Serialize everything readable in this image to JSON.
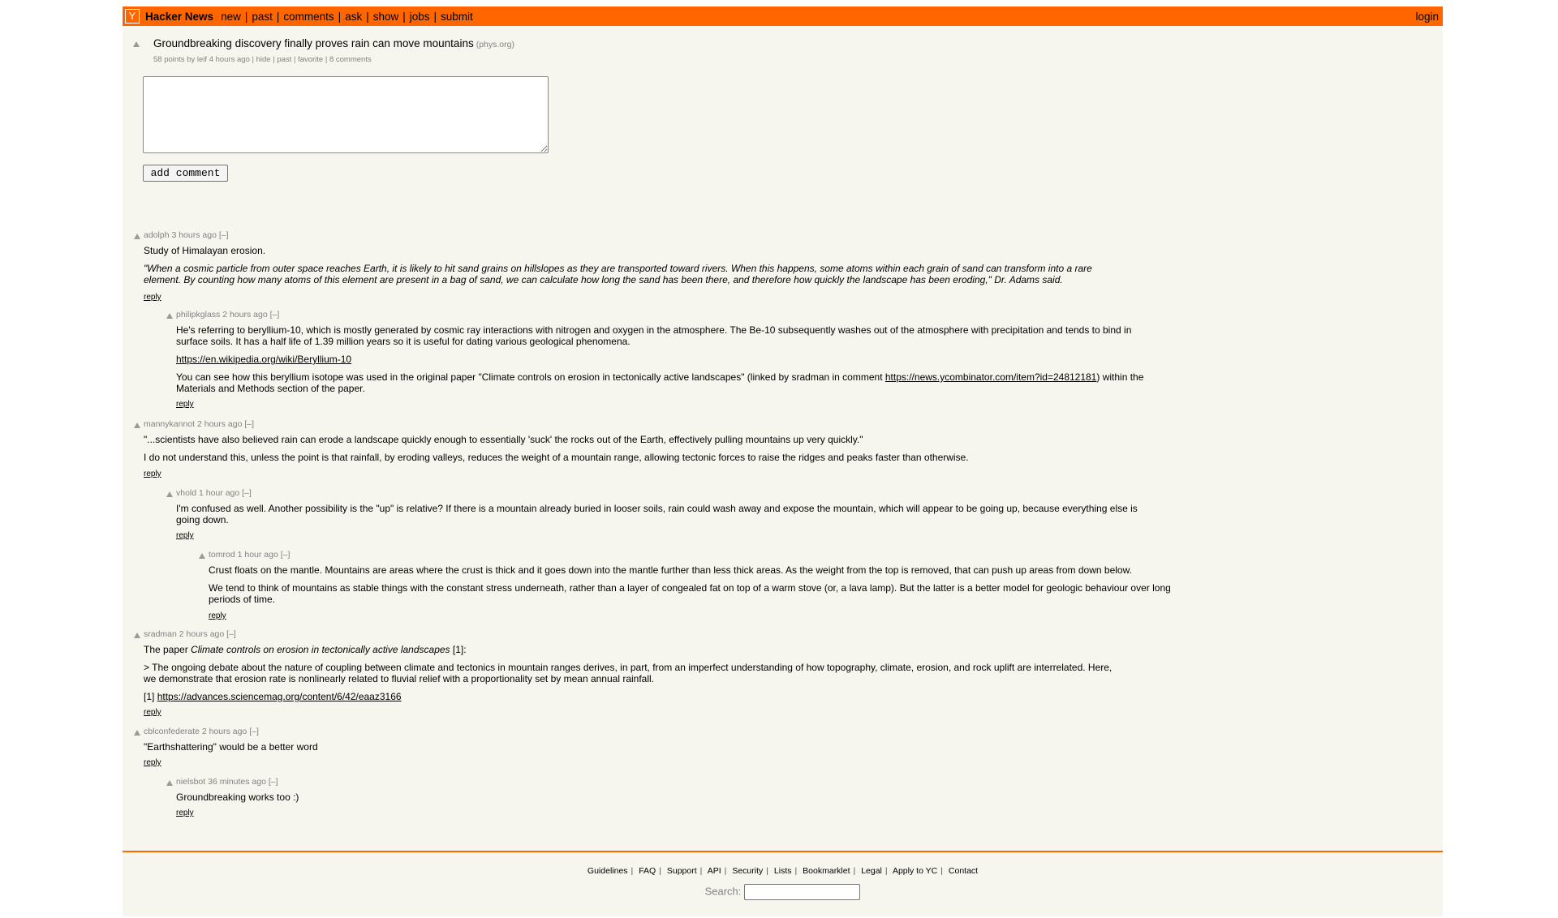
{
  "header": {
    "logo_letter": "Y",
    "brand": "Hacker News",
    "nav": [
      "new",
      "past",
      "comments",
      "ask",
      "show",
      "jobs",
      "submit"
    ],
    "login": "login"
  },
  "story": {
    "title": "Groundbreaking discovery finally proves rain can move mountains",
    "site": "(phys.org)",
    "points": "58 points",
    "by": "by",
    "user": "leif",
    "age": "4 hours ago",
    "hide": "hide",
    "past": "past",
    "favorite": "favorite",
    "comments": "8 comments"
  },
  "add_comment": "add comment",
  "comments": [
    {
      "user": "adolph",
      "age": "3 hours ago",
      "toggle": "[–]",
      "paragraphs": [
        "Study of Himalayan erosion.",
        "\"When a cosmic particle from outer space reaches Earth, it is likely to hit sand grains on hillslopes as they are transported toward rivers. When this happens, some atoms within each grain of sand can transform into a rare element. By counting how many atoms of this element are present in a bag of sand, we can calculate how long the sand has been there, and therefore how quickly the landscape has been eroding,\" Dr. Adams said."
      ],
      "reply": "reply"
    },
    {
      "user": "philipkglass",
      "age": "2 hours ago",
      "toggle": "[–]",
      "paragraphs": [
        "He's referring to beryllium-10, which is mostly generated by cosmic ray interactions with nitrogen and oxygen in the atmosphere. The Be-10 subsequently washes out of the atmosphere with precipitation and tends to bind in surface soils. It has a half life of 1.39 million years so it is useful for dating various geological phenomena.",
        "https://en.wikipedia.org/wiki/Beryllium-10",
        "You can see how this beryllium isotope was used in the original paper \"Climate controls on erosion in tectonically active landscapes\" (linked by sradman in comment ",
        "https://news.ycombinator.com/item?id=24812181",
        ") within the Materials and Methods section of the paper."
      ],
      "reply": "reply"
    },
    {
      "user": "mannykannot",
      "age": "2 hours ago",
      "toggle": "[–]",
      "paragraphs": [
        "\"...scientists have also believed rain can erode a landscape quickly enough to essentially 'suck' the rocks out of the Earth, effectively pulling mountains up very quickly.\"",
        "I do not understand this, unless the point is that rainfall, by eroding valleys, reduces the weight of a mountain range, allowing tectonic forces to raise the ridges and peaks faster than otherwise."
      ],
      "reply": "reply"
    },
    {
      "user": "vhold",
      "age": "1 hour ago",
      "toggle": "[–]",
      "paragraphs": [
        "I'm confused as well. Another possibility is the \"up\" is relative? If there is a mountain already buried in looser soils, rain could wash away and expose the mountain, which will appear to be going up, because everything else is going down."
      ],
      "reply": "reply"
    },
    {
      "user": "tomrod",
      "age": "1 hour ago",
      "toggle": "[–]",
      "paragraphs": [
        "Crust floats on the mantle. Mountains are areas where the crust is thick and it goes down into the mantle further than less thick areas. As the weight from the top is removed, that can push up areas from down below.",
        "We tend to think of mountains as stable things with the constant stress underneath, rather than a layer of congealed fat on top of a warm stove (or, a lava lamp). But the latter is a better model for geologic behaviour over long periods of time."
      ],
      "reply": "reply"
    },
    {
      "user": "sradman",
      "age": "2 hours ago",
      "toggle": "[–]",
      "paragraphs": [
        "The paper ",
        "Climate controls on erosion in tectonically active landscapes",
        " [1]:",
        "> The ongoing debate about the nature of coupling between climate and tectonics in mountain ranges derives, in part, from an imperfect understanding of how topography, climate, erosion, and rock uplift are interrelated. Here, we demonstrate that erosion rate is nonlinearly related to fluvial relief with a proportionality set by mean annual rainfall.",
        "[1] ",
        "https://advances.sciencemag.org/content/6/42/eaaz3166"
      ],
      "reply": "reply"
    },
    {
      "user": "cblconfederate",
      "age": "2 hours ago",
      "toggle": "[–]",
      "paragraphs": [
        "\"Earthshattering\" would be a better word"
      ],
      "reply": "reply"
    },
    {
      "user": "nielsbot",
      "age": "36 minutes ago",
      "toggle": "[–]",
      "paragraphs": [
        "Groundbreaking works too :)"
      ],
      "reply": "reply"
    }
  ],
  "footer": {
    "links": [
      "Guidelines",
      "FAQ",
      "Support",
      "API",
      "Security",
      "Lists",
      "Bookmarklet",
      "Legal",
      "Apply to YC",
      "Contact"
    ],
    "search_label": "Search:"
  }
}
